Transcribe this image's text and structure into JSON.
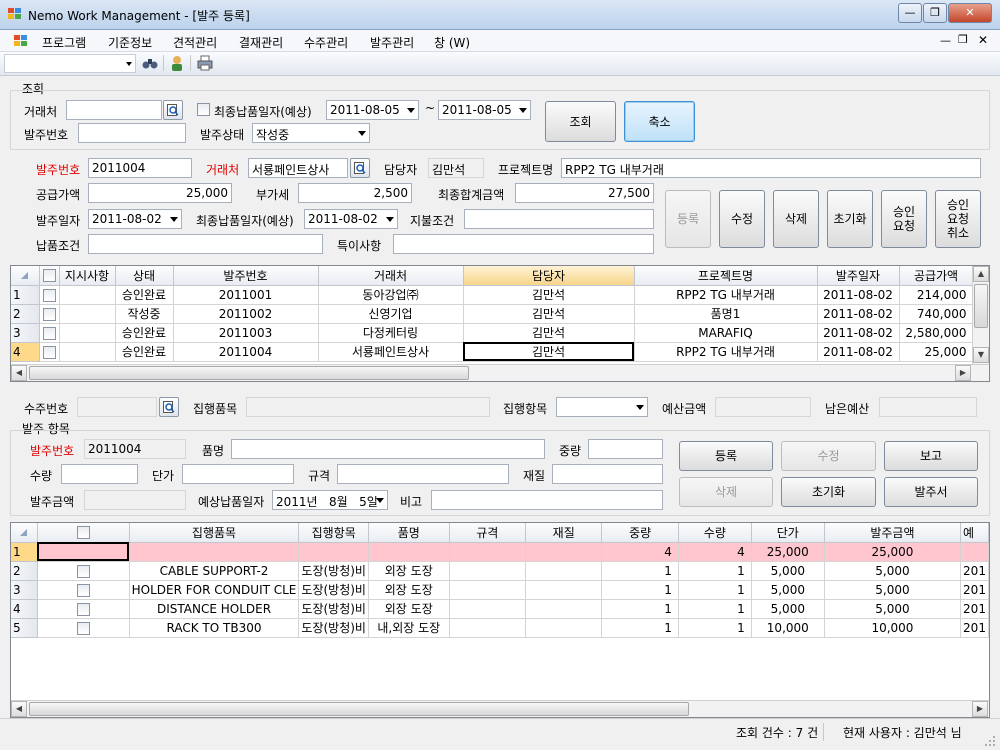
{
  "window": {
    "title": "Nemo Work Management - [발주 등록]"
  },
  "menu": [
    "프로그램",
    "기준정보",
    "견적관리",
    "결재관리",
    "수주관리",
    "발주관리",
    "창 (W)"
  ],
  "search": {
    "group_label": "조회",
    "vendor_label": "거래처",
    "vendor_value": "",
    "final_date_check_label": "최종납품일자(예상)",
    "date_from": "2011-08-05",
    "tilde": "~",
    "date_to": "2011-08-05",
    "po_no_label": "발주번호",
    "po_no_value": "",
    "status_label": "발주상태",
    "status_value": "작성중",
    "search_button": "조회",
    "shrink_button": "축소"
  },
  "form": {
    "po_no_label": "발주번호",
    "po_no_value": "2011004",
    "vendor_label": "거래처",
    "vendor_value": "서룡페인트상사",
    "manager_label": "담당자",
    "manager_value": "김만석",
    "project_label": "프로젝트명",
    "project_value": "RPP2 TG 내부거래",
    "supply_label": "공급가액",
    "supply_value": "25,000",
    "vat_label": "부가세",
    "vat_value": "2,500",
    "total_label": "최종합계금액",
    "total_value": "27,500",
    "po_date_label": "발주일자",
    "po_date_value": "2011-08-02",
    "final_date_label": "최종납품일자(예상)",
    "final_date_value": "2011-08-02",
    "payment_label": "지불조건",
    "payment_value": "",
    "delivery_label": "납품조건",
    "delivery_value": "",
    "remarks_label": "특이사항",
    "remarks_value": "",
    "buttons": {
      "register": "등록",
      "edit": "수정",
      "delete": "삭제",
      "reset": "초기화",
      "approve_req": "승인\n요청",
      "approve_cancel": "승인\n요청\n취소"
    }
  },
  "grid1": {
    "columns": [
      "지시사항",
      "상태",
      "발주번호",
      "거래처",
      "담당자",
      "프로젝트명",
      "발주일자",
      "공급가액"
    ],
    "rows": [
      {
        "n": "1",
        "status": "승인완료",
        "po": "2011001",
        "vendor": "동아강업㈜",
        "mgr": "김만석",
        "proj": "RPP2 TG 내부거래",
        "date": "2011-08-02",
        "amt": "214,000"
      },
      {
        "n": "2",
        "status": "작성중",
        "po": "2011002",
        "vendor": "신영기업",
        "mgr": "김만석",
        "proj": "품명1",
        "date": "2011-08-02",
        "amt": "740,000"
      },
      {
        "n": "3",
        "status": "승인완료",
        "po": "2011003",
        "vendor": "다정케터링",
        "mgr": "김만석",
        "proj": "MARAFIQ",
        "date": "2011-08-02",
        "amt": "2,580,000"
      },
      {
        "n": "4",
        "status": "승인완료",
        "po": "2011004",
        "vendor": "서룡페인트상사",
        "mgr": "김만석",
        "proj": "RPP2 TG 내부거래",
        "date": "2011-08-02",
        "amt": "25,000"
      }
    ]
  },
  "exec": {
    "so_no_label": "수주번호",
    "so_no_value": "",
    "exec_item_label": "집행품목",
    "exec_item_value": "",
    "exec_cat_label": "집행항목",
    "exec_cat_value": "",
    "budget_label": "예산금액",
    "budget_value": "",
    "remaining_label": "남은예산",
    "remaining_value": ""
  },
  "item": {
    "group_label": "발주 항목",
    "po_no_label": "발주번호",
    "po_no_value": "2011004",
    "name_label": "품명",
    "name_value": "",
    "weight_label": "중량",
    "weight_value": "",
    "qty_label": "수량",
    "qty_value": "",
    "price_label": "단가",
    "price_value": "",
    "spec_label": "규격",
    "spec_value": "",
    "material_label": "재질",
    "material_value": "",
    "amount_label": "발주금액",
    "amount_value": "",
    "exp_date_label": "예상납품일자",
    "exp_date_value": "2011년   8월   5일",
    "note_label": "비고",
    "note_value": "",
    "buttons": {
      "register": "등록",
      "edit": "수정",
      "report": "보고",
      "delete": "삭제",
      "reset": "초기화",
      "po_doc": "발주서"
    }
  },
  "grid2": {
    "columns": [
      "집행품목",
      "집행항목",
      "품명",
      "규격",
      "재질",
      "중량",
      "수량",
      "단가",
      "발주금액",
      "예"
    ],
    "rows": [
      {
        "n": "1",
        "item": "",
        "cat": "",
        "name": "",
        "spec": "",
        "mat": "",
        "w": "4",
        "q": "4",
        "p": "25,000",
        "a": "25,000",
        "x": ""
      },
      {
        "n": "2",
        "item": "CABLE SUPPORT-2",
        "cat": "도장(방청)비",
        "name": "외장 도장",
        "spec": "",
        "mat": "",
        "w": "1",
        "q": "1",
        "p": "5,000",
        "a": "5,000",
        "x": "201"
      },
      {
        "n": "3",
        "item": "HOLDER FOR CONDUIT CLE",
        "cat": "도장(방청)비",
        "name": "외장 도장",
        "spec": "",
        "mat": "",
        "w": "1",
        "q": "1",
        "p": "5,000",
        "a": "5,000",
        "x": "201"
      },
      {
        "n": "4",
        "item": "DISTANCE HOLDER",
        "cat": "도장(방청)비",
        "name": "외장 도장",
        "spec": "",
        "mat": "",
        "w": "1",
        "q": "1",
        "p": "5,000",
        "a": "5,000",
        "x": "201"
      },
      {
        "n": "5",
        "item": "RACK TO TB300",
        "cat": "도장(방청)비",
        "name": "내,외장 도장",
        "spec": "",
        "mat": "",
        "w": "1",
        "q": "1",
        "p": "10,000",
        "a": "10,000",
        "x": "201"
      }
    ]
  },
  "status": {
    "count": "조회 건수 : 7 건",
    "user": "현재 사용자 : 김만석 님"
  }
}
